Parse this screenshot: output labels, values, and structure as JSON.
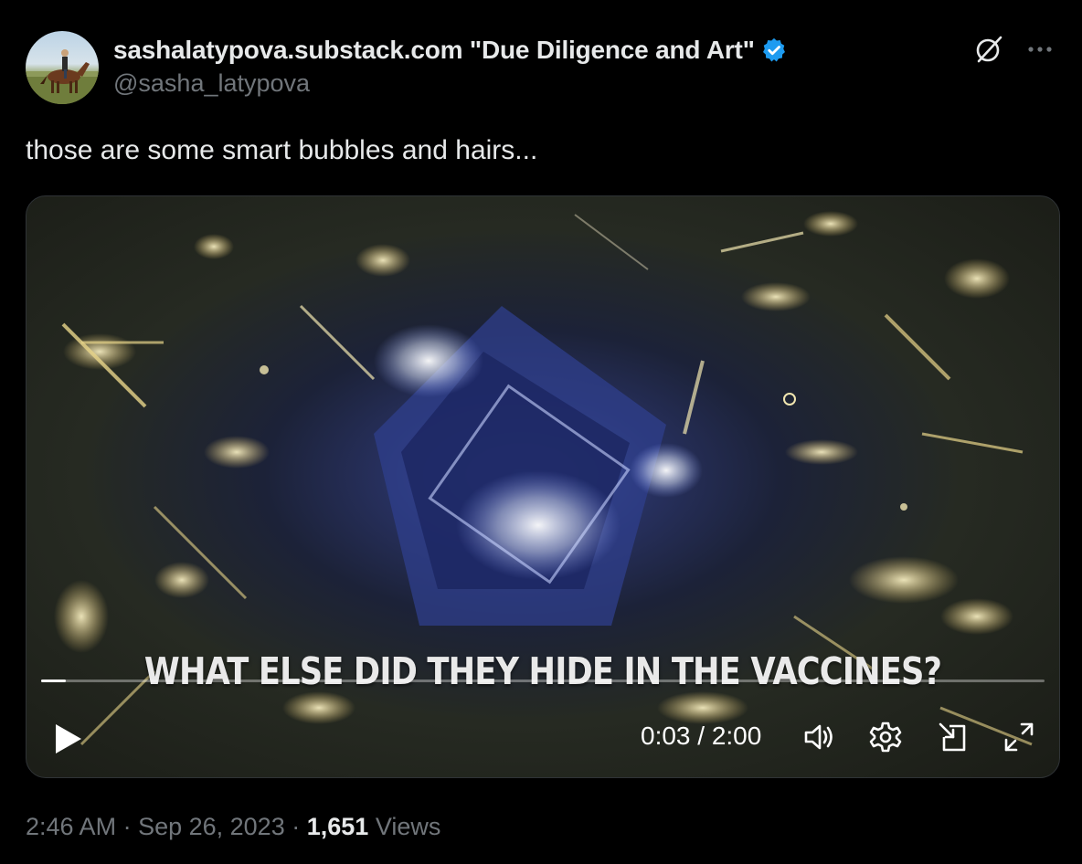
{
  "author": {
    "display_name": "sashalatypova.substack.com \"Due Diligence and Art\"",
    "handle": "@sasha_latypova",
    "verified": true,
    "verified_color": "#1d9bf0"
  },
  "header_icons": {
    "grok": "grok-slash-circle-icon",
    "more": "more-horizontal-icon"
  },
  "tweet": {
    "text": "those are some smart bubbles and hairs..."
  },
  "video": {
    "caption": "WHAT ELSE DID THEY HIDE IN THE VACCINES?",
    "current_time": "0:03",
    "duration": "2:00",
    "time_display": "0:03 / 2:00",
    "progress_fraction": 0.025,
    "controls": [
      "play-icon",
      "volume-icon",
      "settings-gear-icon",
      "picture-in-picture-icon",
      "fullscreen-icon"
    ]
  },
  "meta": {
    "time": "2:46 AM",
    "date": "Sep 26, 2023",
    "views_count": "1,651",
    "views_label": "Views"
  },
  "colors": {
    "background": "#000000",
    "text_primary": "#e7e9ea",
    "text_secondary": "#71767b",
    "accent": "#1d9bf0"
  }
}
